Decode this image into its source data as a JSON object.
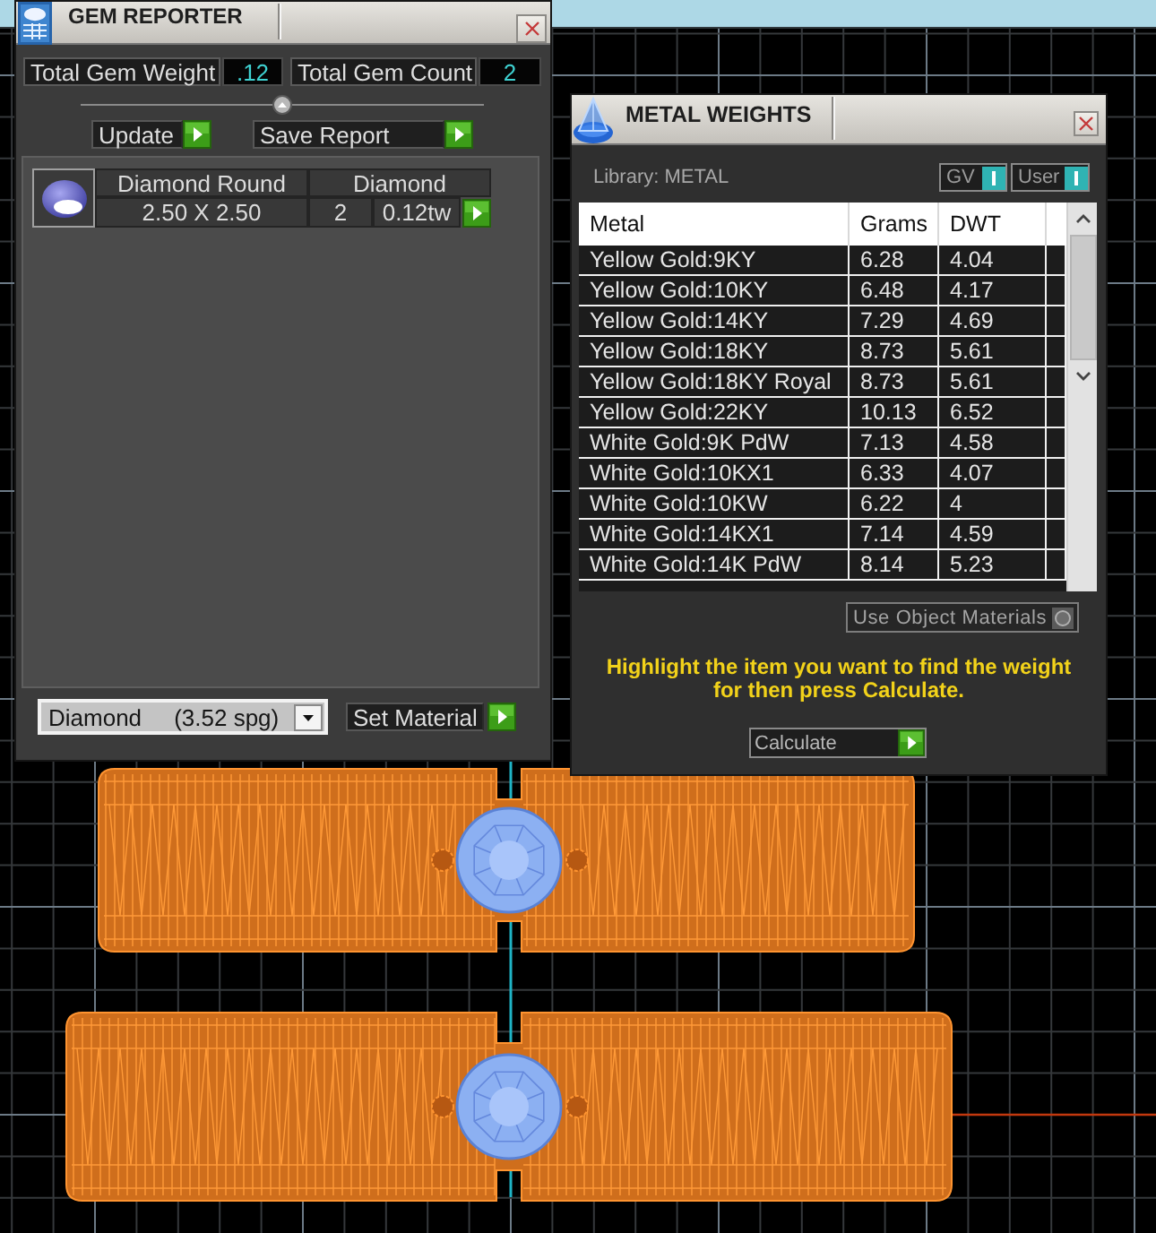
{
  "gem_reporter": {
    "title": "GEM REPORTER",
    "total_gem_weight": {
      "label": "Total Gem Weight",
      "value": ".12"
    },
    "total_gem_count": {
      "label": "Total Gem Count",
      "value": "2"
    },
    "buttons": [
      "Update",
      "Save Report"
    ],
    "gems": [
      {
        "name": "Diamond Round",
        "material": "Diamond",
        "size": "2.50 X 2.50",
        "count": "2",
        "weight": "0.12tw"
      }
    ],
    "material_select": {
      "value": "Diamond     (3.52 spg)"
    },
    "set_material_button": "Set Material"
  },
  "metal_weights": {
    "title": "METAL WEIGHTS",
    "library": "Library: METAL",
    "toggles": [
      {
        "label": "GV",
        "on": true
      },
      {
        "label": "User",
        "on": true
      }
    ],
    "table": {
      "columns": [
        "Metal",
        "Grams",
        "DWT"
      ],
      "rows": [
        {
          "cells": [
            "Yellow Gold:9KY",
            "6.28",
            "4.04"
          ],
          "selected": false
        },
        {
          "cells": [
            "Yellow Gold:10KY",
            "6.48",
            "4.17"
          ],
          "selected": false
        },
        {
          "cells": [
            "Yellow Gold:14KY",
            "7.29",
            "4.69"
          ],
          "selected": false
        },
        {
          "cells": [
            "Yellow Gold:18KY",
            "8.73",
            "5.61"
          ],
          "selected": false
        },
        {
          "cells": [
            "Yellow Gold:18KY Royal",
            "8.73",
            "5.61"
          ],
          "selected": false
        },
        {
          "cells": [
            "Yellow Gold:22KY",
            "10.13",
            "6.52"
          ],
          "selected": false
        },
        {
          "cells": [
            "White Gold:9K PdW",
            "7.13",
            "4.58"
          ],
          "selected": false
        },
        {
          "cells": [
            "White Gold:10KX1",
            "6.33",
            "4.07"
          ],
          "selected": false
        },
        {
          "cells": [
            "White Gold:10KW",
            "6.22",
            "4"
          ],
          "selected": false
        },
        {
          "cells": [
            "White Gold:14KX1",
            "7.14",
            "4.59"
          ],
          "selected": false
        },
        {
          "cells": [
            "White Gold:14K PdW",
            "8.14",
            "5.23"
          ],
          "selected": false
        }
      ]
    },
    "use_object_materials": {
      "label": "Use Object Materials",
      "checked": false
    },
    "instruction": "Highlight the item you want to find the weight for then press Calculate.",
    "calculate_button": "Calculate"
  }
}
